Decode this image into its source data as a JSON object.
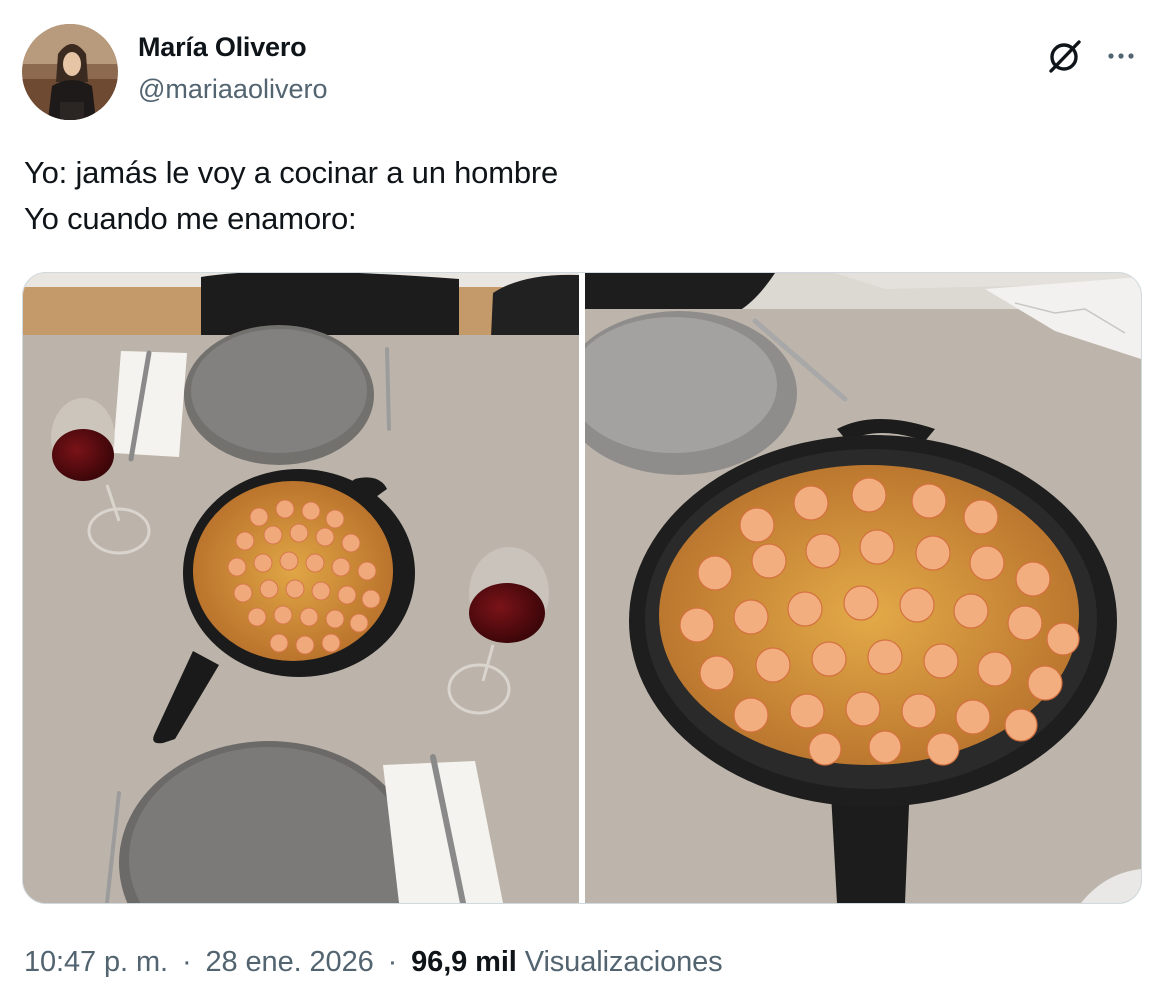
{
  "author": {
    "display_name": "María Olivero",
    "handle": "@mariaaolivero"
  },
  "header_icons": {
    "grok": "grok-icon",
    "more": "more-options-icon"
  },
  "tweet": {
    "lines": [
      "Yo: jamás le voy a cocinar a un hombre",
      "Yo cuando me enamoro:"
    ]
  },
  "media": {
    "photos": [
      "Top-down view of a table set for two: a cast-iron skillet of shrimp rice in the centre, grey plates, forks, knives on napkins and two glasses of red wine",
      "Close-up of a cast-iron skillet filled with yellow rice topped with shrimp, grey plates and a fork behind it"
    ]
  },
  "meta": {
    "time": "10:47 p. m.",
    "separator": "·",
    "date": "28 ene. 2026",
    "views_count": "96,9 mil",
    "views_label": "Visualizaciones"
  },
  "colors": {
    "text_primary": "#0f1419",
    "text_secondary": "#536471",
    "border": "#cfd9de",
    "table": "#bdb5ab"
  }
}
